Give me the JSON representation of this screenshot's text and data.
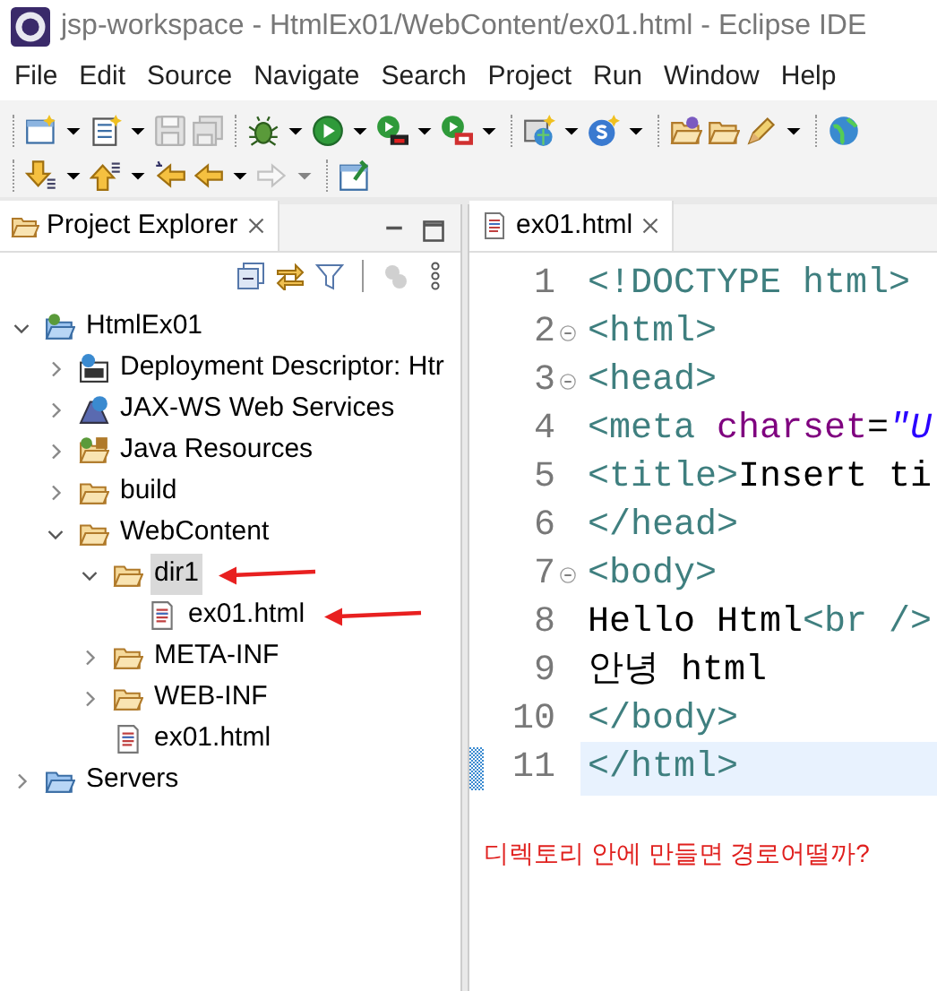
{
  "window": {
    "title": "jsp-workspace - HtmlEx01/WebContent/ex01.html - Eclipse IDE"
  },
  "menu": [
    "File",
    "Edit",
    "Source",
    "Navigate",
    "Search",
    "Project",
    "Run",
    "Window",
    "Help"
  ],
  "toolbar_rows": [
    [
      {
        "kind": "new-window",
        "dropdown": true,
        "disabled": false
      },
      {
        "kind": "new-file",
        "dropdown": true,
        "disabled": false
      },
      {
        "kind": "save",
        "dropdown": false,
        "disabled": true
      },
      {
        "kind": "save-all",
        "dropdown": false,
        "disabled": true
      },
      {
        "kind": "separator"
      },
      {
        "kind": "bug",
        "dropdown": true,
        "disabled": false
      },
      {
        "kind": "run",
        "dropdown": true,
        "disabled": false
      },
      {
        "kind": "run-server",
        "dropdown": true,
        "disabled": false
      },
      {
        "kind": "stop-server",
        "dropdown": true,
        "disabled": false
      },
      {
        "kind": "separator"
      },
      {
        "kind": "new-server",
        "dropdown": true,
        "disabled": false
      },
      {
        "kind": "new-s",
        "dropdown": true,
        "disabled": false
      },
      {
        "kind": "separator"
      },
      {
        "kind": "open-folder",
        "dropdown": false,
        "disabled": false
      },
      {
        "kind": "open-file",
        "dropdown": false,
        "disabled": false
      },
      {
        "kind": "pen",
        "dropdown": true,
        "disabled": false
      },
      {
        "kind": "separator"
      },
      {
        "kind": "globe",
        "dropdown": false,
        "disabled": false
      }
    ],
    [
      {
        "kind": "next",
        "dropdown": true,
        "disabled": false
      },
      {
        "kind": "prev",
        "dropdown": true,
        "disabled": false
      },
      {
        "kind": "last-edit",
        "dropdown": false,
        "disabled": false
      },
      {
        "kind": "back",
        "dropdown": true,
        "disabled": false
      },
      {
        "kind": "forward",
        "dropdown": true,
        "disabled": true
      },
      {
        "kind": "separator"
      },
      {
        "kind": "pin",
        "dropdown": false,
        "disabled": false
      }
    ]
  ],
  "explorer": {
    "tab": {
      "label": "Project Explorer",
      "selected": true
    },
    "view_toolbar": [
      {
        "kind": "collapse",
        "disabled": false
      },
      {
        "kind": "link",
        "disabled": false
      },
      {
        "kind": "filter",
        "disabled": false
      },
      {
        "kind": "separator"
      },
      {
        "kind": "gear",
        "disabled": true
      },
      {
        "kind": "kebab",
        "disabled": false
      }
    ],
    "tree": [
      {
        "label": "HtmlEx01",
        "kind": "project",
        "expanded": true,
        "selected": false,
        "marked": false,
        "children": [
          {
            "label": "Deployment Descriptor: Htr",
            "kind": "descriptor",
            "expanded": false,
            "selected": false,
            "marked": false
          },
          {
            "label": "JAX-WS Web Services",
            "kind": "webservice",
            "expanded": false,
            "selected": false,
            "marked": false
          },
          {
            "label": "Java Resources",
            "kind": "javares",
            "expanded": false,
            "selected": false,
            "marked": false
          },
          {
            "label": "build",
            "kind": "folder",
            "expanded": false,
            "selected": false,
            "marked": false
          },
          {
            "label": "WebContent",
            "kind": "folder",
            "expanded": true,
            "selected": false,
            "marked": false,
            "children": [
              {
                "label": "dir1",
                "kind": "folder",
                "expanded": true,
                "selected": true,
                "marked": true,
                "children": [
                  {
                    "label": "ex01.html",
                    "kind": "file",
                    "selected": false,
                    "marked": true
                  }
                ]
              },
              {
                "label": "META-INF",
                "kind": "folder",
                "expanded": false,
                "selected": false,
                "marked": false
              },
              {
                "label": "WEB-INF",
                "kind": "folder",
                "expanded": false,
                "selected": false,
                "marked": false
              },
              {
                "label": "ex01.html",
                "kind": "file",
                "selected": false,
                "marked": false
              }
            ]
          }
        ]
      },
      {
        "label": "Servers",
        "kind": "servers",
        "expanded": false,
        "selected": false,
        "marked": false
      }
    ]
  },
  "editor": {
    "tab": {
      "label": "ex01.html",
      "selected": true
    },
    "lines": [
      {
        "number": "1",
        "fold": false,
        "current": false,
        "tokens": [
          {
            "kind": "tag",
            "text": "<!DOCTYPE html>"
          }
        ]
      },
      {
        "number": "2",
        "fold": true,
        "current": false,
        "tokens": [
          {
            "kind": "tag",
            "text": "<html>"
          }
        ]
      },
      {
        "number": "3",
        "fold": true,
        "current": false,
        "tokens": [
          {
            "kind": "tag",
            "text": "<head>"
          }
        ]
      },
      {
        "number": "4",
        "fold": false,
        "current": false,
        "tokens": [
          {
            "kind": "tag",
            "text": "<meta "
          },
          {
            "kind": "attr",
            "text": "charset"
          },
          {
            "kind": "text",
            "text": "="
          },
          {
            "kind": "string",
            "text": "\"U"
          }
        ]
      },
      {
        "number": "5",
        "fold": false,
        "current": false,
        "tokens": [
          {
            "kind": "tag",
            "text": "<title>"
          },
          {
            "kind": "text",
            "text": "Insert ti"
          }
        ]
      },
      {
        "number": "6",
        "fold": false,
        "current": false,
        "tokens": [
          {
            "kind": "tag",
            "text": "</head>"
          }
        ]
      },
      {
        "number": "7",
        "fold": true,
        "current": false,
        "tokens": [
          {
            "kind": "tag",
            "text": "<body>"
          }
        ]
      },
      {
        "number": "8",
        "fold": false,
        "current": false,
        "tokens": [
          {
            "kind": "text",
            "text": "Hello Html"
          },
          {
            "kind": "tag",
            "text": "<br />"
          }
        ]
      },
      {
        "number": "9",
        "fold": false,
        "current": false,
        "tokens": [
          {
            "kind": "text",
            "text": "안녕 html"
          }
        ]
      },
      {
        "number": "10",
        "fold": false,
        "current": false,
        "tokens": [
          {
            "kind": "tag",
            "text": "</body>"
          }
        ]
      },
      {
        "number": "11",
        "fold": false,
        "current": true,
        "tokens": [
          {
            "kind": "tag",
            "text": "</html>"
          }
        ]
      }
    ],
    "annotation": "디렉토리 안에 만들면 경로어떨까?"
  }
}
